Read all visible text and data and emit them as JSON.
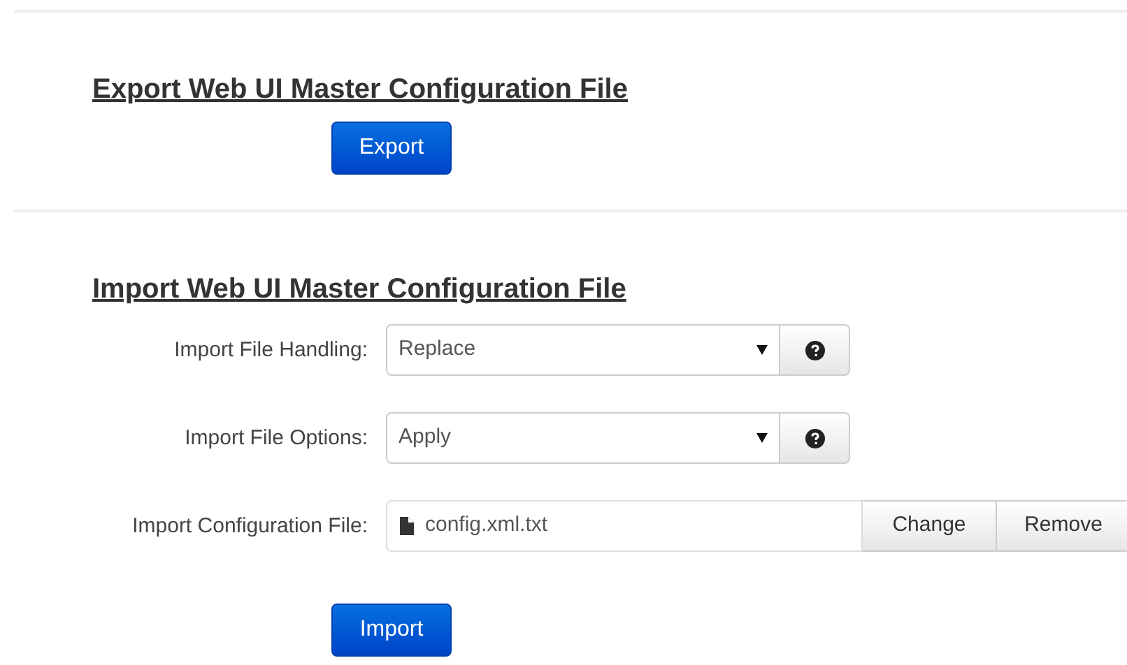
{
  "export_section": {
    "heading": "Export Web UI Master Configuration File",
    "button": "Export"
  },
  "import_section": {
    "heading": "Import Web UI Master Configuration File",
    "fields": [
      {
        "kind": "select",
        "label": "Import File Handling:",
        "value": "Replace"
      },
      {
        "kind": "select",
        "label": "Import File Options:",
        "value": "Apply"
      },
      {
        "kind": "file",
        "label": "Import Configuration File:",
        "value": "config.xml.txt",
        "buttons": [
          "Change",
          "Remove"
        ]
      }
    ],
    "button": "Import"
  }
}
